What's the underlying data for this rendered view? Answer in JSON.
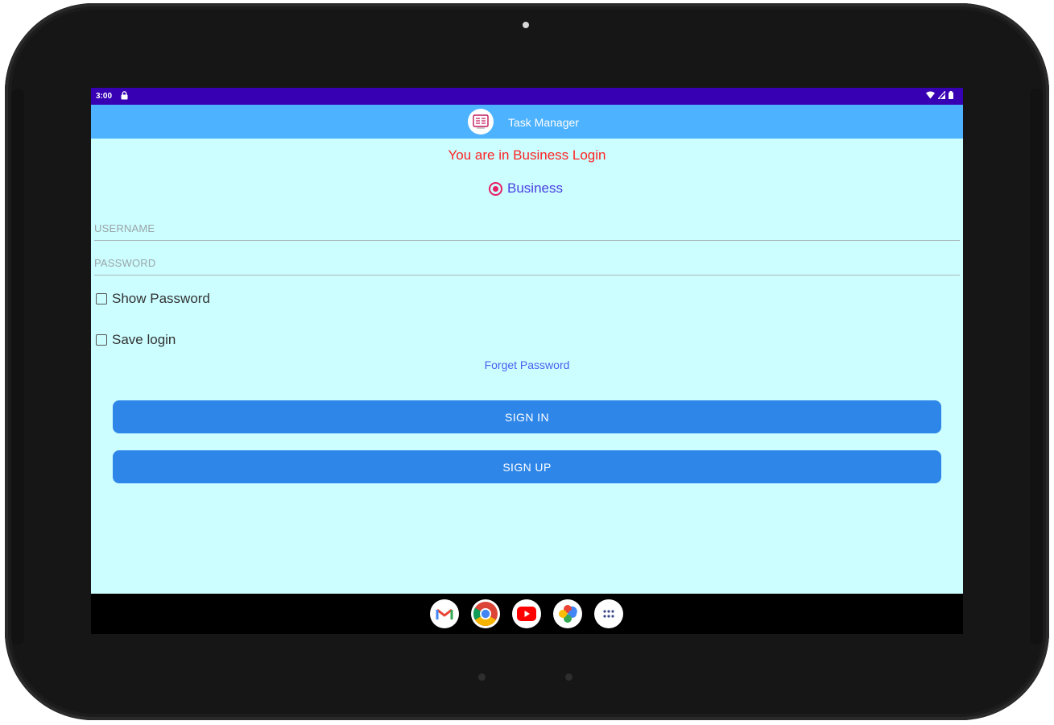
{
  "status_bar": {
    "time": "3:00",
    "icons": [
      "lock-icon",
      "wifi-icon",
      "signal-icon",
      "battery-icon"
    ]
  },
  "app_bar": {
    "title": "Task Manager",
    "logo_icon": "task-manager-logo-icon",
    "color": "#4db2ff"
  },
  "login": {
    "heading": "You are in Business Login",
    "radio_label": "Business",
    "username_placeholder": "USERNAME",
    "password_placeholder": "PASSWORD",
    "show_password_label": "Show Password",
    "save_login_label": "Save login",
    "forget_password_label": "Forget Password",
    "sign_in_label": "SIGN IN",
    "sign_up_label": "SIGN UP"
  },
  "colors": {
    "status_bar": "#3700b3",
    "background": "#ccfeff",
    "heading": "#ff2222",
    "radio_accent": "#e91e63",
    "link": "#4a5ff0",
    "button": "#2e86e8"
  },
  "dock": {
    "apps": [
      "gmail-icon",
      "chrome-icon",
      "youtube-icon",
      "photos-icon",
      "app-drawer-icon"
    ]
  }
}
